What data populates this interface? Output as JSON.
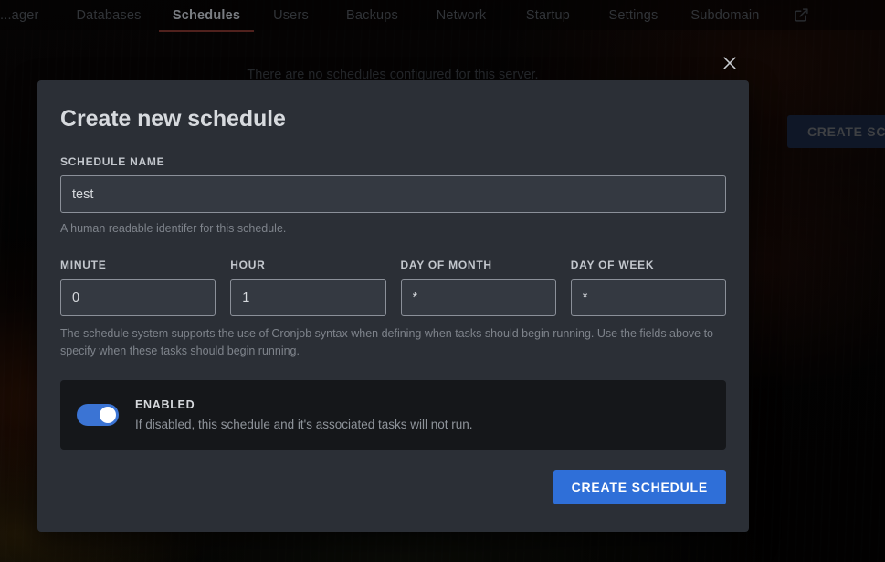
{
  "topnav": {
    "items": [
      {
        "label": "...ager",
        "active": false
      },
      {
        "label": "Databases",
        "active": false
      },
      {
        "label": "Schedules",
        "active": true
      },
      {
        "label": "Users",
        "active": false
      },
      {
        "label": "Backups",
        "active": false
      },
      {
        "label": "Network",
        "active": false
      },
      {
        "label": "Startup",
        "active": false
      },
      {
        "label": "Settings",
        "active": false
      },
      {
        "label": "Subdomain",
        "active": false
      }
    ],
    "external_link_icon": "external-link-icon"
  },
  "background": {
    "empty_state_text": "There are no schedules configured for this server.",
    "create_schedule_button": "CREATE SCH"
  },
  "modal": {
    "close_icon": "close-icon",
    "title": "Create new schedule",
    "name_field": {
      "label": "SCHEDULE NAME",
      "value": "test",
      "placeholder": "",
      "help": "A human readable identifer for this schedule."
    },
    "cron_fields": [
      {
        "label": "MINUTE",
        "value": "0",
        "name": "minute"
      },
      {
        "label": "HOUR",
        "value": "1",
        "name": "hour"
      },
      {
        "label": "DAY OF MONTH",
        "value": "*",
        "name": "day-of-month"
      },
      {
        "label": "DAY OF WEEK",
        "value": "*",
        "name": "day-of-week"
      }
    ],
    "cron_help": "The schedule system supports the use of Cronjob syntax when defining when tasks should begin running. Use the fields above to specify when these tasks should begin running.",
    "enabled": {
      "label": "ENABLED",
      "description": "If disabled, this schedule and it's associated tasks will not run.",
      "state": "on"
    },
    "submit_label": "CREATE SCHEDULE"
  },
  "colors": {
    "accent_blue": "#2f6fd8",
    "toggle_blue": "#3b74d4",
    "active_tab_underline": "#7a332c",
    "modal_bg": "#2b2f36",
    "enabled_box_bg": "#15171a"
  }
}
